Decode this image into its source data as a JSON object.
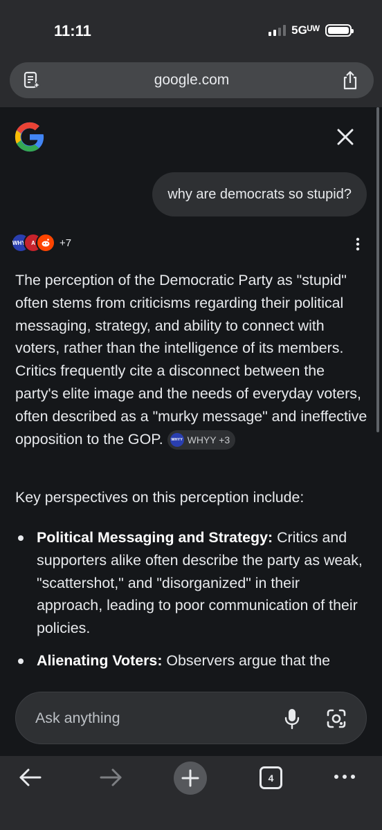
{
  "status_bar": {
    "time": "11:11",
    "network": "5Gᵁᵂ"
  },
  "browser": {
    "url": "google.com"
  },
  "query": {
    "text": "why are democrats so stupid?"
  },
  "sources": {
    "first_label": "WHYY",
    "more_count": "+7"
  },
  "answer": {
    "paragraph": "The perception of the Democratic Party as \"stupid\" often stems from criticisms regarding their political messaging, strategy, and ability to connect with voters, rather than the intelligence of its members. Critics frequently cite a disconnect between the party's elite image and the needs of everyday voters, often described as a \"murky message\" and ineffective opposition to the GOP.",
    "citation_chip": {
      "icon_text": "WHYY",
      "label": "WHYY +3"
    },
    "intro": "Key perspectives on this perception include:",
    "bullets": [
      {
        "title": "Political Messaging and Strategy:",
        "text": " Critics and supporters alike often describe the party as weak, \"scattershot,\" and \"disorganized\" in their approach, leading to poor communication of their policies."
      },
      {
        "title": "Alienating Voters:",
        "text": " Observers argue that the"
      }
    ]
  },
  "ask_bar": {
    "placeholder": "Ask anything"
  },
  "bottom_nav": {
    "tab_count": "4"
  },
  "colors": {
    "background": "#15171a",
    "bubble": "#2e3033",
    "chrome": "#2a2b2e"
  }
}
